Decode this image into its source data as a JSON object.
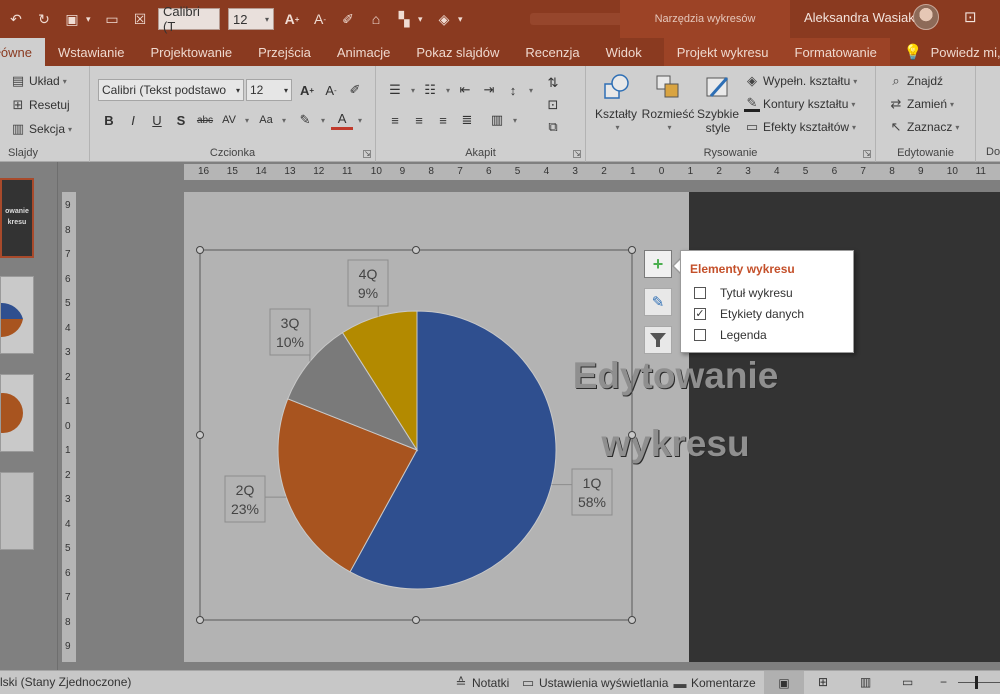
{
  "quick_access": {
    "font_name": "Calibri (T",
    "font_size": "12"
  },
  "titlebar": {
    "context_tools": "Narzędzia wykresów",
    "user_name": "Aleksandra Wasiak"
  },
  "tabs": [
    "łówne",
    "Wstawianie",
    "Projektowanie",
    "Przejścia",
    "Animacje",
    "Pokaz slajdów",
    "Recenzja",
    "Widok",
    "Projekt wykresu",
    "Formatowanie"
  ],
  "tell_me": "Powiedz mi, co chcesz z",
  "ribbon": {
    "slides": {
      "layout": "Układ",
      "reset": "Resetuj",
      "section": "Sekcja",
      "label": "Slajdy"
    },
    "font": {
      "name": "Calibri (Tekst podstawo",
      "size": "12",
      "label": "Czcionka"
    },
    "paragraph": {
      "label": "Akapit"
    },
    "drawing": {
      "shapes": "Kształty",
      "arrange": "Rozmieść",
      "quick_styles_1": "Szybkie",
      "quick_styles_2": "style",
      "fill": "Wypełn. kształtu",
      "outline": "Kontury kształtu",
      "effects": "Efekty kształtów",
      "label": "Rysowanie"
    },
    "editing": {
      "find": "Znajdź",
      "replace": "Zamień",
      "select": "Zaznacz",
      "label": "Edytowanie",
      "next_label": "Do"
    }
  },
  "ruler": {
    "h": [
      "16",
      "15",
      "14",
      "13",
      "12",
      "11",
      "10",
      "9",
      "8",
      "7",
      "6",
      "5",
      "4",
      "3",
      "2",
      "1",
      "0",
      "1",
      "2",
      "3",
      "4",
      "5",
      "6",
      "7",
      "8",
      "9",
      "10",
      "11"
    ],
    "v": [
      "9",
      "8",
      "7",
      "6",
      "5",
      "4",
      "3",
      "2",
      "1",
      "0",
      "1",
      "2",
      "3",
      "4",
      "5",
      "6",
      "7",
      "8",
      "9"
    ]
  },
  "thumbnails": {
    "first_title_1": "owanie",
    "first_title_2": "kresu"
  },
  "slide": {
    "title_line1": "Edytowanie",
    "title_line2": "wykresu"
  },
  "chart_data": {
    "type": "pie",
    "categories": [
      "1Q",
      "2Q",
      "3Q",
      "4Q"
    ],
    "values": [
      58,
      23,
      10,
      9
    ],
    "data_labels": [
      "58%",
      "23%",
      "10%",
      "9%"
    ],
    "colors": [
      "#2f4f8f",
      "#a8541f",
      "#7a7a7a",
      "#b38a00"
    ],
    "title": "",
    "legend": "none"
  },
  "chart_elements_popup": {
    "title": "Elementy wykresu",
    "items": [
      {
        "label": "Tytuł wykresu",
        "checked": false
      },
      {
        "label": "Etykiety danych",
        "checked": true
      },
      {
        "label": "Legenda",
        "checked": false
      }
    ]
  },
  "statusbar": {
    "language": "lski (Stany Zjednoczone)",
    "notes": "Notatki",
    "display_settings": "Ustawienia wyświetlania",
    "comments": "Komentarze"
  },
  "colors": {
    "accent": "#8a3a20",
    "popup_title": "#c4502a"
  }
}
